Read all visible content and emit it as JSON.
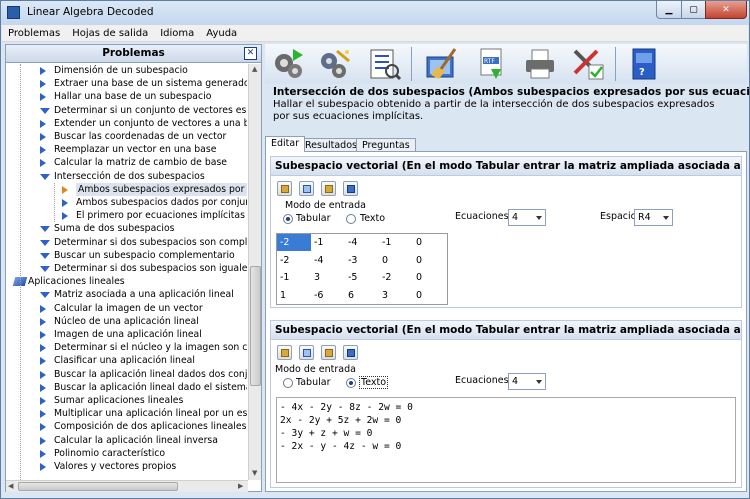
{
  "window": {
    "title": "Linear Algebra Decoded"
  },
  "menu": [
    "Problemas",
    "Hojas de salida",
    "Idioma",
    "Ayuda"
  ],
  "left_panel": {
    "title": "Problemas",
    "tree": [
      {
        "label": "Dimensión de un subespacio",
        "level": 2,
        "icon": "play"
      },
      {
        "label": "Extraer una base de un sistema generador",
        "level": 2,
        "icon": "play"
      },
      {
        "label": "Hallar una base de un subespacio",
        "level": 2,
        "icon": "play"
      },
      {
        "label": "Determinar si un conjunto de vectores es una base",
        "level": 2,
        "icon": "down"
      },
      {
        "label": "Extender un conjunto de vectores a una base",
        "level": 2,
        "icon": "play"
      },
      {
        "label": "Buscar las coordenadas de un vector",
        "level": 2,
        "icon": "play"
      },
      {
        "label": "Reemplazar un vector en una base",
        "level": 2,
        "icon": "play"
      },
      {
        "label": "Calcular la matriz de cambio de base",
        "level": 2,
        "icon": "play"
      },
      {
        "label": "Intersección de dos subespacios",
        "level": 2,
        "icon": "down"
      },
      {
        "label": "Ambos subespacios expresados por sus ecuaciones",
        "level": 3,
        "icon": "play-orange",
        "selected": true
      },
      {
        "label": "Ambos subespacios dados por conjuntos generadores",
        "level": 3,
        "icon": "play"
      },
      {
        "label": "El primero por ecuaciones implícitas y el segundo",
        "level": 3,
        "icon": "play"
      },
      {
        "label": "Suma de dos subespacios",
        "level": 2,
        "icon": "down"
      },
      {
        "label": "Determinar si dos subespacios son complementarios",
        "level": 2,
        "icon": "down"
      },
      {
        "label": "Buscar un subespacio complementario",
        "level": 2,
        "icon": "down"
      },
      {
        "label": "Determinar si dos subespacios son iguales",
        "level": 2,
        "icon": "down"
      },
      {
        "label": "Aplicaciones lineales",
        "level": 1,
        "icon": "book"
      },
      {
        "label": "Matriz asociada a una aplicación lineal",
        "level": 2,
        "icon": "down"
      },
      {
        "label": "Calcular la imagen de un vector",
        "level": 2,
        "icon": "play"
      },
      {
        "label": "Núcleo de una aplicación lineal",
        "level": 2,
        "icon": "play"
      },
      {
        "label": "Imagen de una aplicación lineal",
        "level": 2,
        "icon": "play"
      },
      {
        "label": "Determinar si el núcleo y la imagen son complementarios",
        "level": 2,
        "icon": "play"
      },
      {
        "label": "Clasificar una aplicación lineal",
        "level": 2,
        "icon": "play"
      },
      {
        "label": "Buscar la aplicación lineal dados dos conjuntos de vectores",
        "level": 2,
        "icon": "play"
      },
      {
        "label": "Buscar la aplicación lineal dado el sistema generador",
        "level": 2,
        "icon": "play"
      },
      {
        "label": "Sumar aplicaciones lineales",
        "level": 2,
        "icon": "play"
      },
      {
        "label": "Multiplicar una aplicación lineal por un escalar",
        "level": 2,
        "icon": "play"
      },
      {
        "label": "Composición de dos aplicaciones lineales",
        "level": 2,
        "icon": "play"
      },
      {
        "label": "Calcular la aplicación lineal inversa",
        "level": 2,
        "icon": "play"
      },
      {
        "label": "Polinomio característico",
        "level": 2,
        "icon": "play"
      },
      {
        "label": "Valores y vectores propios",
        "level": 2,
        "icon": "play"
      }
    ]
  },
  "problem": {
    "title": "Intersección de dos subespacios (Ambos subespacios expresados por sus ecuaciones",
    "description": "Hallar el subespacio obtenido a partir de la intersección de dos subespacios expresados por sus ecuaciones implícitas."
  },
  "tabs": [
    "Editar",
    "Resultados",
    "Preguntas"
  ],
  "section1": {
    "header": "Subespacio vectorial (En el modo Tabular entrar la matriz ampliada asociada a las ecuaciones",
    "modo_label": "Modo de entrada",
    "radio_tabular": "Tabular",
    "radio_texto": "Texto",
    "ecuaciones_label": "Ecuaciones",
    "ecuaciones_value": "4",
    "espacio_label": "Espacio",
    "espacio_value": "R4",
    "matrix": [
      [
        "-2",
        "-1",
        "-4",
        "-1",
        "0"
      ],
      [
        "-2",
        "-4",
        "-3",
        "0",
        "0"
      ],
      [
        "-1",
        "3",
        "-5",
        "-2",
        "0"
      ],
      [
        "1",
        "-6",
        "6",
        "3",
        "0"
      ]
    ]
  },
  "section2": {
    "header": "Subespacio vectorial (En el modo Tabular entrar la matriz ampliada asociada a las ecuaciones",
    "modo_label": "Modo de entrada",
    "radio_tabular": "Tabular",
    "radio_texto": "Texto",
    "ecuaciones_label": "Ecuaciones",
    "ecuaciones_value": "4",
    "equations": [
      "- 4x - 2y - 8z - 2w = 0",
      "2x - 2y + 5z + 2w = 0",
      "- 3y + z + w = 0",
      "- 2x - y - 4z - w = 0"
    ]
  },
  "icons": [
    "gears-icon",
    "gears-magic-icon",
    "checklist-icon",
    "clear-broom-icon",
    "rtf-export-icon",
    "printer-icon",
    "tools-check-icon",
    "help-book-icon"
  ]
}
